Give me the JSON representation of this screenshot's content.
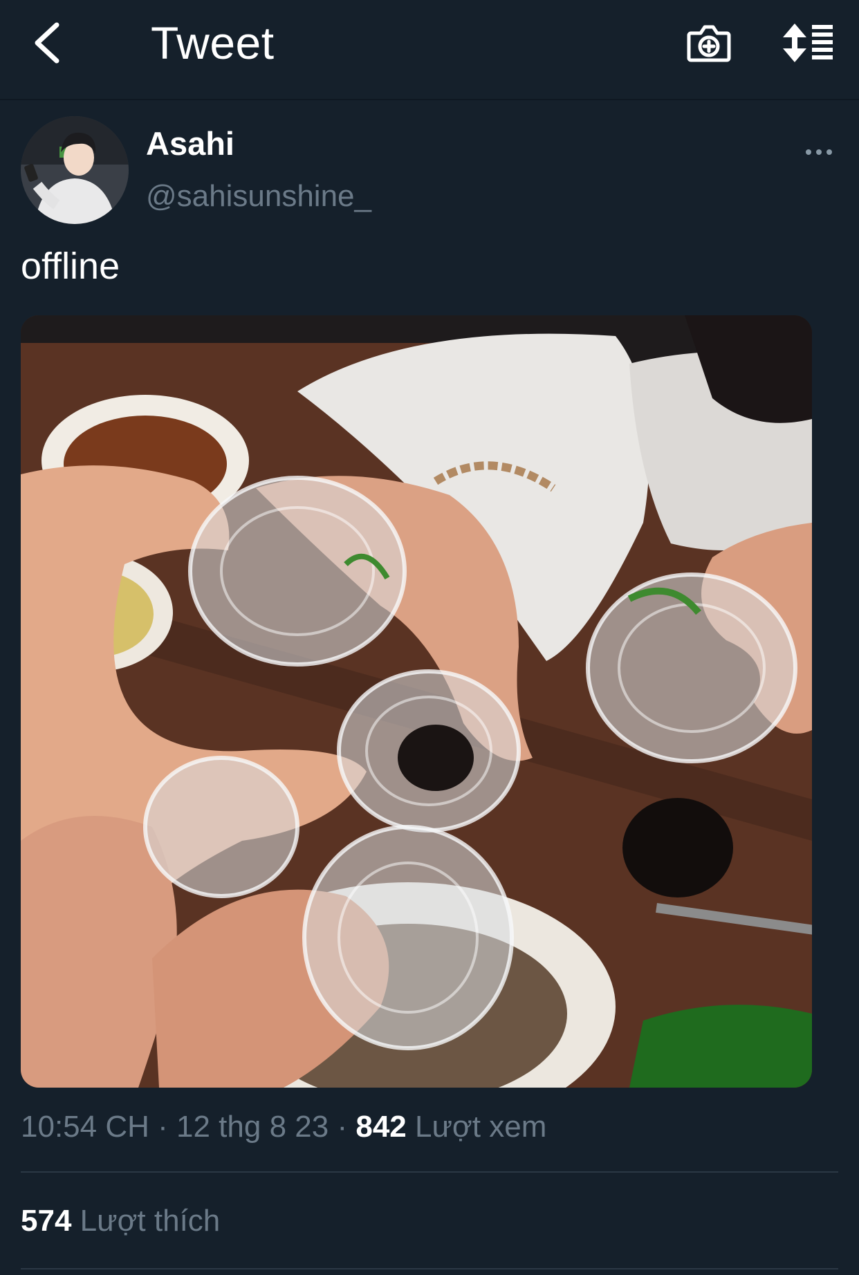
{
  "header": {
    "title": "Tweet",
    "icons": {
      "back": "chevron-left-icon",
      "camera": "camera-plus-icon",
      "sort": "sort-list-icon"
    }
  },
  "tweet": {
    "author": {
      "display_name": "Asahi",
      "handle": "@sahisunshine_"
    },
    "text": "offline",
    "more_icon": "more-horizontal-icon",
    "media_alt": "",
    "meta": {
      "time": "10:54 CH",
      "separator": "·",
      "date": "12 thg 8 23",
      "views_count": "842",
      "views_label": "Lượt xem"
    },
    "stats": {
      "likes_count": "574",
      "likes_label": "Lượt thích"
    }
  },
  "colors": {
    "background": "#15202b",
    "text_primary": "#ffffff",
    "text_secondary": "#6b7a88",
    "divider": "#2b3845"
  }
}
